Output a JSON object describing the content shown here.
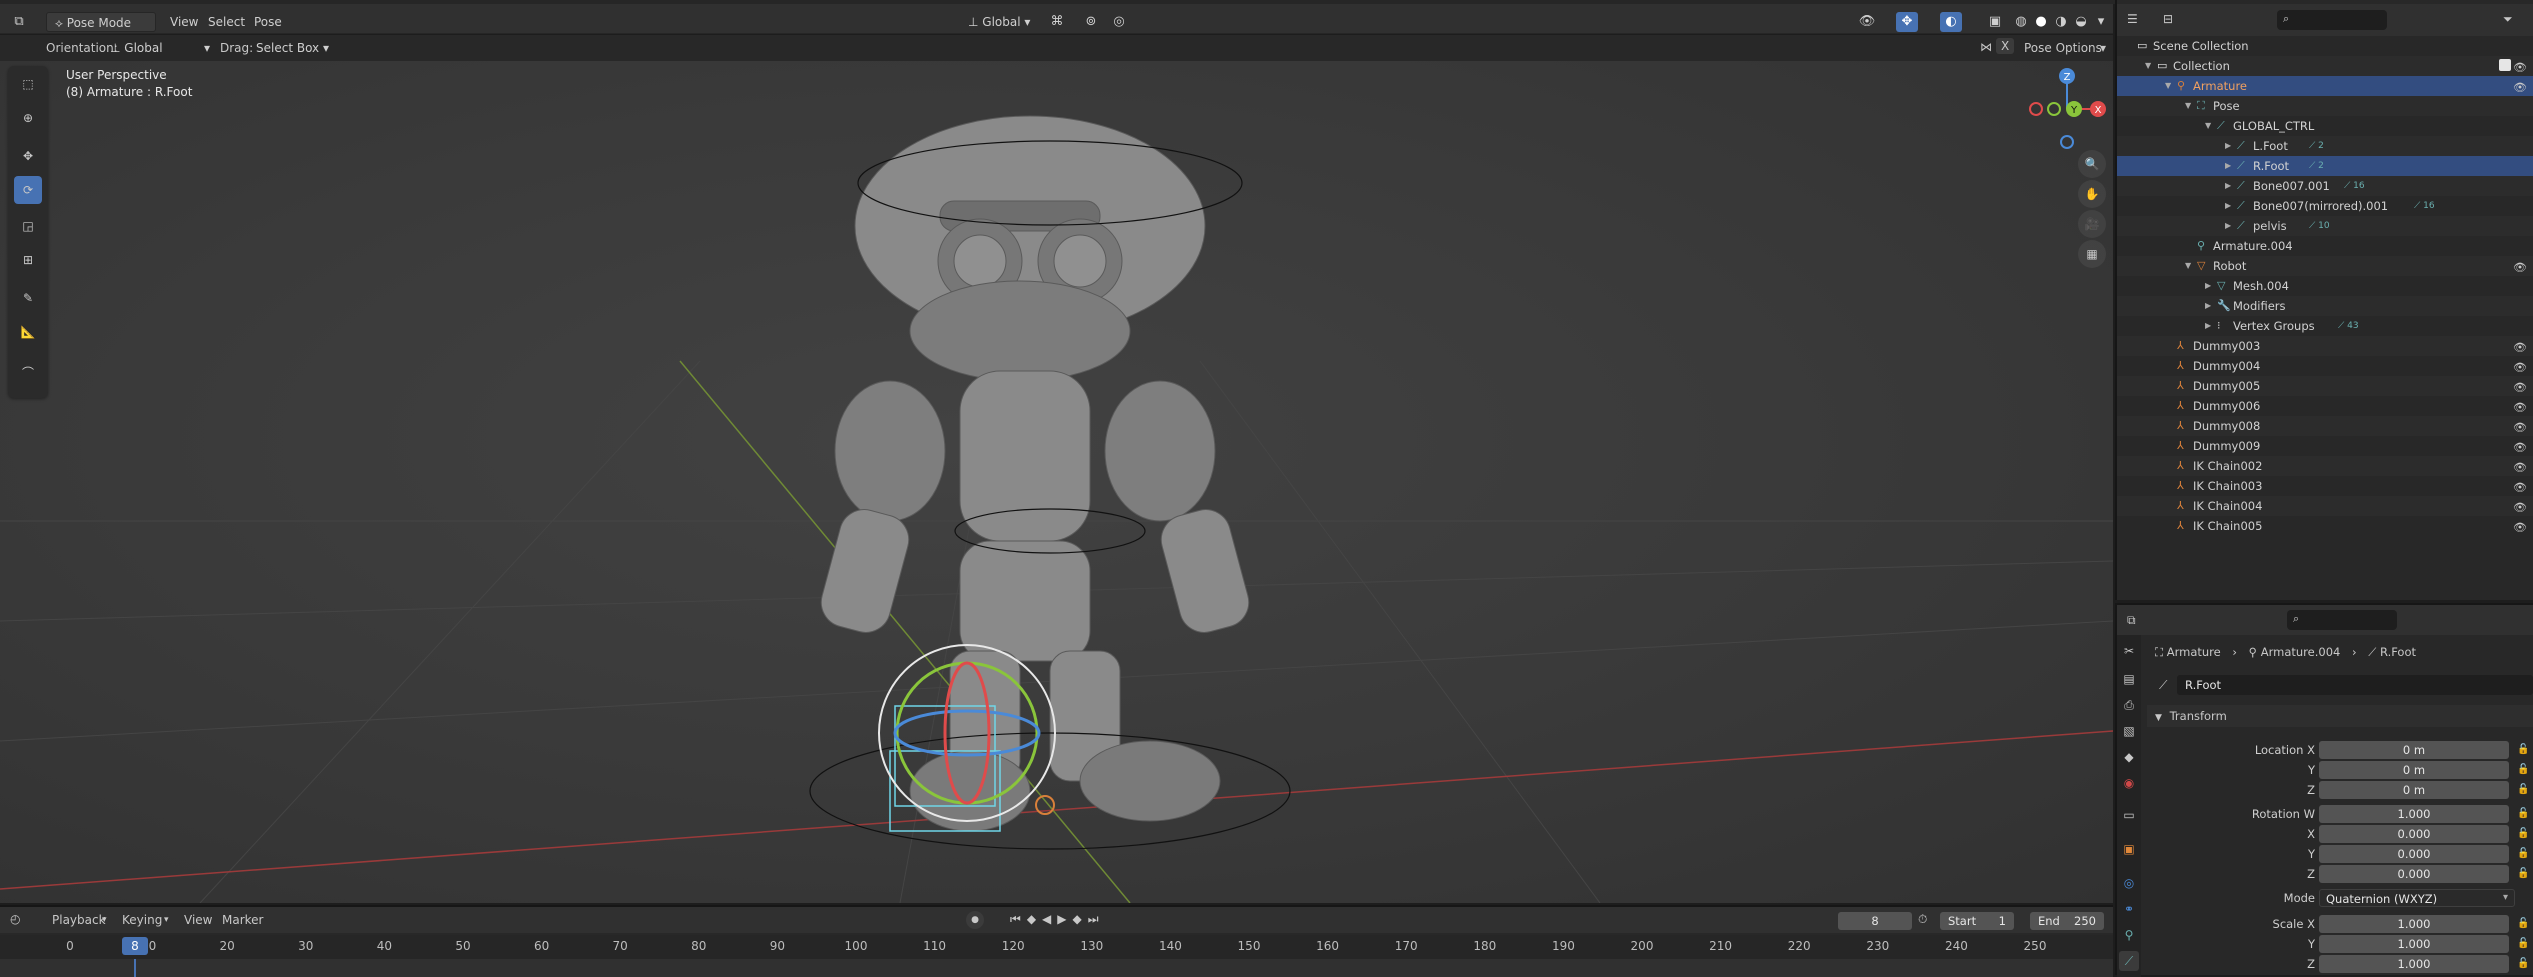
{
  "viewport_header": {
    "mode": "Pose Mode",
    "menus": [
      "View",
      "Select",
      "Pose"
    ],
    "transform_orientation": "Global"
  },
  "tool_header": {
    "orientation_label": "Orientation:",
    "orientation_value": "Global",
    "drag_label": "Drag:",
    "drag_value": "Select Box",
    "x_label": "X",
    "pose_options": "Pose Options"
  },
  "viewport": {
    "perspective": "User Perspective",
    "object_info": "(8) Armature : R.Foot",
    "gizmo": {
      "z": "Z",
      "y": "Y",
      "x": "X"
    }
  },
  "outliner": {
    "rows": [
      {
        "name": "Scene Collection",
        "indent": 0,
        "icon": "scene-collection-icon",
        "arrow": "",
        "eye": false
      },
      {
        "name": "Collection",
        "indent": 1,
        "icon": "collection-icon",
        "arrow": "▼",
        "eye": true,
        "check": true
      },
      {
        "name": "Armature",
        "indent": 2,
        "icon": "armature-icon",
        "arrow": "▼",
        "eye": true,
        "selected": true
      },
      {
        "name": "Pose",
        "indent": 3,
        "icon": "pose-icon",
        "arrow": "▼"
      },
      {
        "name": "GLOBAL_CTRL",
        "indent": 4,
        "icon": "bone-icon",
        "arrow": "▼"
      },
      {
        "name": "L.Foot",
        "indent": 5,
        "icon": "bone-icon",
        "arrow": "▶",
        "badge": "2"
      },
      {
        "name": "R.Foot",
        "indent": 5,
        "icon": "bone-icon",
        "arrow": "▶",
        "badge": "2",
        "selected": true
      },
      {
        "name": "Bone007.001",
        "indent": 5,
        "icon": "bone-icon",
        "arrow": "▶",
        "badge": "16"
      },
      {
        "name": "Bone007(mirrored).001",
        "indent": 5,
        "icon": "bone-icon",
        "arrow": "▶",
        "badge": "16"
      },
      {
        "name": "pelvis",
        "indent": 5,
        "icon": "bone-icon",
        "arrow": "▶",
        "badge": "10"
      },
      {
        "name": "Armature.004",
        "indent": 3,
        "icon": "armature-data-icon",
        "arrow": ""
      },
      {
        "name": "Robot",
        "indent": 3,
        "icon": "mesh-object-icon",
        "arrow": "▼",
        "eye": true
      },
      {
        "name": "Mesh.004",
        "indent": 4,
        "icon": "mesh-data-icon",
        "arrow": "▶"
      },
      {
        "name": "Modifiers",
        "indent": 4,
        "icon": "wrench-icon",
        "arrow": "▶"
      },
      {
        "name": "Vertex Groups",
        "indent": 4,
        "icon": "vertex-groups-icon",
        "arrow": "▶",
        "badge": "43"
      },
      {
        "name": "Dummy003",
        "indent": 2,
        "icon": "empty-icon",
        "arrow": "",
        "eye": true
      },
      {
        "name": "Dummy004",
        "indent": 2,
        "icon": "empty-icon",
        "arrow": "",
        "eye": true
      },
      {
        "name": "Dummy005",
        "indent": 2,
        "icon": "empty-icon",
        "arrow": "",
        "eye": true
      },
      {
        "name": "Dummy006",
        "indent": 2,
        "icon": "empty-icon",
        "arrow": "",
        "eye": true
      },
      {
        "name": "Dummy008",
        "indent": 2,
        "icon": "empty-icon",
        "arrow": "",
        "eye": true
      },
      {
        "name": "Dummy009",
        "indent": 2,
        "icon": "empty-icon",
        "arrow": "",
        "eye": true
      },
      {
        "name": "IK Chain002",
        "indent": 2,
        "icon": "empty-icon",
        "arrow": "",
        "eye": true
      },
      {
        "name": "IK Chain003",
        "indent": 2,
        "icon": "empty-icon",
        "arrow": "",
        "eye": true
      },
      {
        "name": "IK Chain004",
        "indent": 2,
        "icon": "empty-icon",
        "arrow": "",
        "eye": true
      },
      {
        "name": "IK Chain005",
        "indent": 2,
        "icon": "empty-icon",
        "arrow": "",
        "eye": true
      }
    ]
  },
  "properties": {
    "breadcrumb": [
      "Armature",
      "Armature.004",
      "R.Foot"
    ],
    "bone_name": "R.Foot",
    "panel_title": "Transform",
    "fields": [
      {
        "label": "Location X",
        "value": "0 m"
      },
      {
        "label": "Y",
        "value": "0 m"
      },
      {
        "label": "Z",
        "value": "0 m"
      },
      {
        "label": "Rotation W",
        "value": "1.000"
      },
      {
        "label": "X",
        "value": "0.000"
      },
      {
        "label": "Y",
        "value": "0.000"
      },
      {
        "label": "Z",
        "value": "0.000"
      },
      {
        "label": "Mode",
        "value": "Quaternion (WXYZ)"
      },
      {
        "label": "Scale X",
        "value": "1.000"
      },
      {
        "label": "Y",
        "value": "1.000"
      },
      {
        "label": "Z",
        "value": "1.000"
      }
    ]
  },
  "timeline": {
    "menus": [
      "Playback",
      "Keying",
      "View",
      "Marker"
    ],
    "current_frame": "8",
    "start_label": "Start",
    "start_value": "1",
    "end_label": "End",
    "end_value": "250",
    "ruler": [
      "0",
      "10",
      "20",
      "30",
      "40",
      "50",
      "60",
      "70",
      "80",
      "90",
      "100",
      "110",
      "120",
      "130",
      "140",
      "150",
      "160",
      "170",
      "180",
      "190",
      "200",
      "210",
      "220",
      "230",
      "240",
      "250"
    ],
    "playhead": "8"
  },
  "colors": {
    "accent": "#4772b3",
    "selected_row": "#334d80",
    "x_axis": "#e04b4b",
    "y_axis": "#8ac53b",
    "z_axis": "#4a8ad8"
  }
}
